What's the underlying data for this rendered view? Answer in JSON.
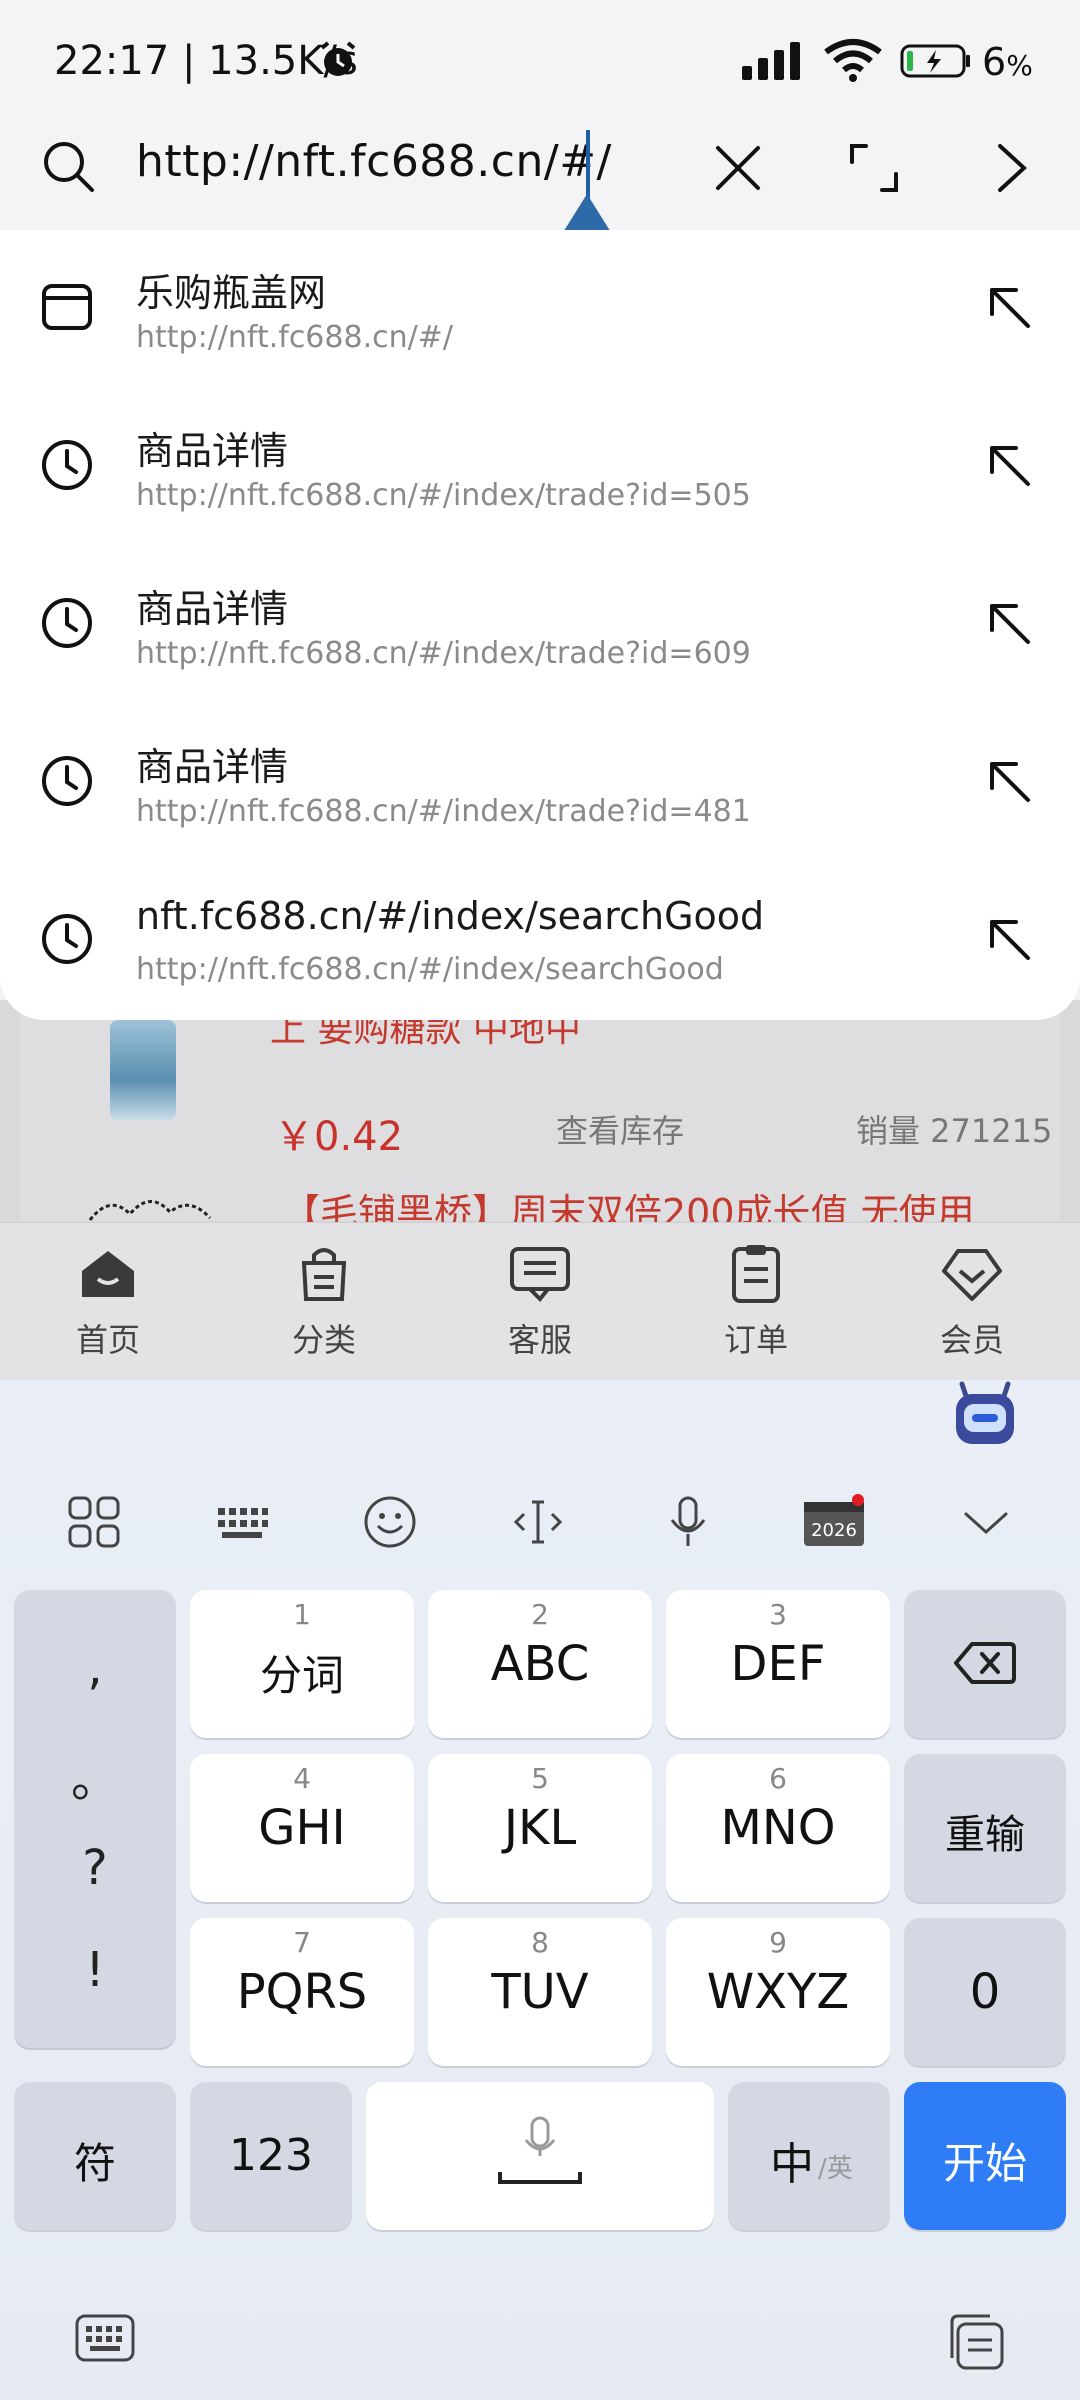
{
  "status": {
    "time": "22:17 | 13.5K/s",
    "battery_pct": "6",
    "battery_suffix": "%"
  },
  "urlbar": {
    "url": "http://nft.fc688.cn/#/"
  },
  "suggestions": [
    {
      "icon": "tab-icon",
      "title": "乐购瓶盖网",
      "url": "http://nft.fc688.cn/#/"
    },
    {
      "icon": "history-icon",
      "title": "商品详情",
      "url": "http://nft.fc688.cn/#/index/trade?id=505"
    },
    {
      "icon": "history-icon",
      "title": "商品详情",
      "url": "http://nft.fc688.cn/#/index/trade?id=609"
    },
    {
      "icon": "history-icon",
      "title": "商品详情",
      "url": "http://nft.fc688.cn/#/index/trade?id=481"
    },
    {
      "icon": "history-icon",
      "title": "nft.fc688.cn/#/index/searchGood",
      "url": "http://nft.fc688.cn/#/index/searchGood"
    }
  ],
  "product": {
    "title_partial": "上 要购糖款 中地中",
    "price": "￥0.42",
    "stock": "查看库存",
    "sales": "销量 271215",
    "next_title": "【毛铺黑桥】周末双倍200成长值 无使用"
  },
  "tabbar": [
    {
      "label": "首页",
      "icon": "home-icon"
    },
    {
      "label": "分类",
      "icon": "bag-icon"
    },
    {
      "label": "客服",
      "icon": "chat-icon"
    },
    {
      "label": "订单",
      "icon": "order-icon"
    },
    {
      "label": "会员",
      "icon": "member-icon"
    }
  ],
  "keyboard": {
    "punctuation": [
      ",",
      "。",
      "?",
      "!"
    ],
    "keys": [
      {
        "num": "1",
        "label": "分词"
      },
      {
        "num": "2",
        "label": "ABC"
      },
      {
        "num": "3",
        "label": "DEF"
      },
      {
        "num": "4",
        "label": "GHI"
      },
      {
        "num": "5",
        "label": "JKL"
      },
      {
        "num": "6",
        "label": "MNO"
      },
      {
        "num": "7",
        "label": "PQRS"
      },
      {
        "num": "8",
        "label": "TUV"
      },
      {
        "num": "9",
        "label": "WXYZ"
      }
    ],
    "reinput": "重输",
    "zero": "0",
    "symbols": "符",
    "numbers": "123",
    "lang_main": "中",
    "lang_sub": "/英",
    "start": "开始",
    "toolbar_badge": "2026"
  },
  "colors": {
    "accent": "#2f7df6",
    "price": "#c8322a",
    "handle": "#2d6aa7"
  }
}
